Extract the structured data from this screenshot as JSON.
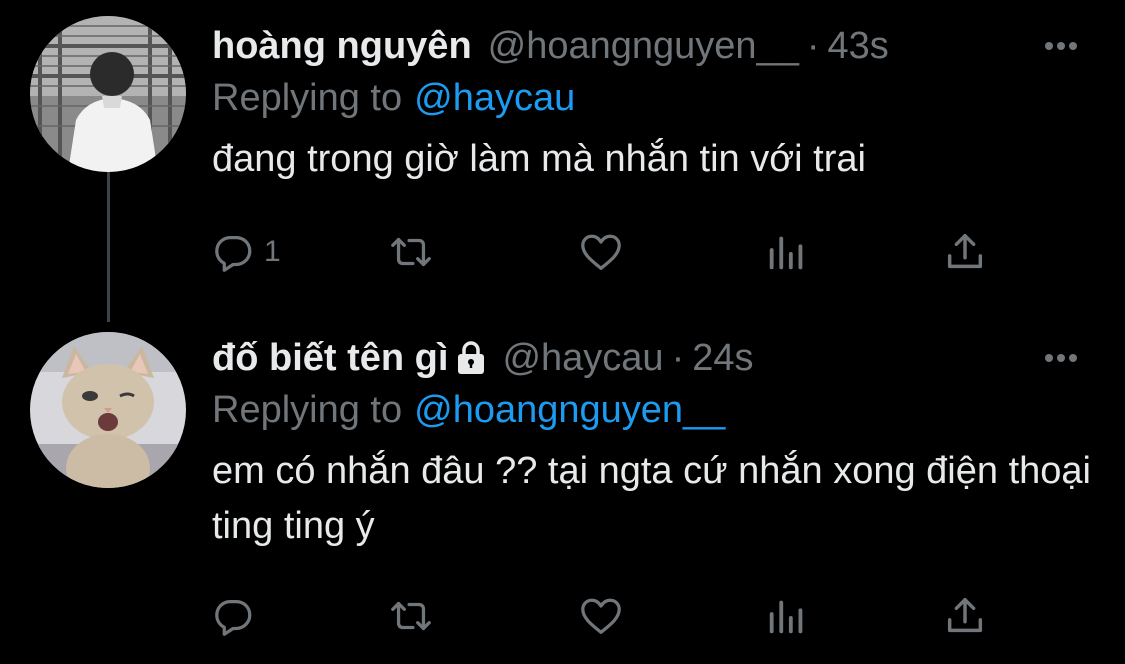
{
  "colors": {
    "background": "#000000",
    "text_primary": "#e7e9ea",
    "text_secondary": "#71767b",
    "accent": "#1d9bf0",
    "thread_line": "#3d4246"
  },
  "tweets": [
    {
      "display_name": "hoàng nguyên",
      "handle": "@hoangnguyen__",
      "separator": "·",
      "time": "43s",
      "replying_label": "Replying to",
      "replying_to": "@haycau",
      "text": "đang trong giờ làm mà nhắn tin với trai",
      "reply_count": "1",
      "avatar": "person-back-photo",
      "protected": false
    },
    {
      "display_name": "đố biết tên gì",
      "handle": "@haycau",
      "separator": "·",
      "time": "24s",
      "replying_label": "Replying to",
      "replying_to": "@hoangnguyen__",
      "text": "em có nhắn đâu ?? tại ngta cứ nhắn xong điện thoại ting ting ý",
      "reply_count": "",
      "avatar": "cat-photo",
      "protected": true
    }
  ],
  "icons": {
    "more": "more-dots-icon",
    "lock": "lock-icon",
    "reply": "reply-bubble-icon",
    "retweet": "retweet-icon",
    "like": "heart-icon",
    "views": "views-bars-icon",
    "share": "share-upload-icon"
  }
}
